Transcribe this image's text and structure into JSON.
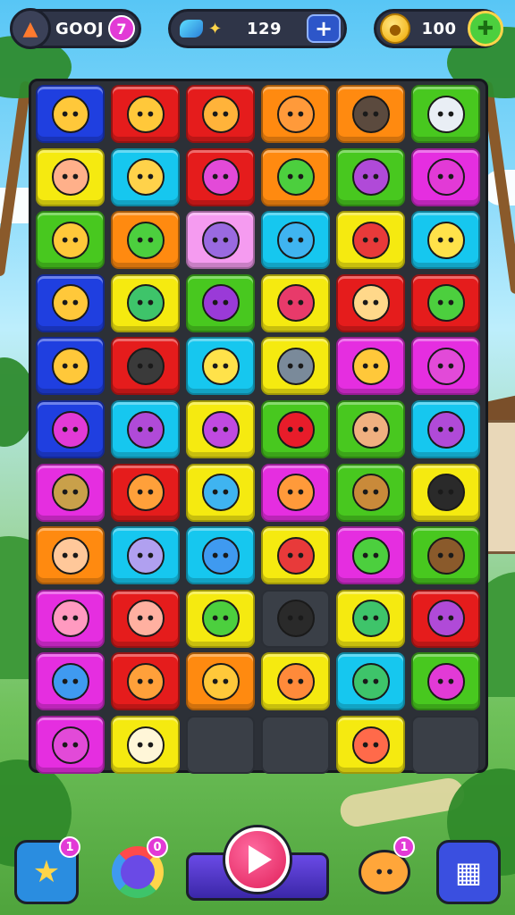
{
  "hud": {
    "left": {
      "avatar_icon": "dino-icon",
      "value": "GOOJ",
      "badge": "7"
    },
    "middle": {
      "gem_icon": "gem-icon",
      "character_icon": "runner-icon",
      "value": "129",
      "plus_label": "+"
    },
    "right": {
      "coin_icon": "coin-icon",
      "value": "100",
      "add_icon": "puzzle-plus-icon"
    }
  },
  "board": {
    "columns": 6,
    "rows": 11,
    "tile_colors": {
      "blue": "#1f3fe0",
      "red": "#e51c1c",
      "orange": "#ff8a10",
      "green": "#48c81f",
      "yellow": "#f5ea10",
      "cyan": "#16c7ef",
      "magenta": "#e52ee0",
      "pink": "#f59bf0",
      "empty": "#3a3f47"
    },
    "tiles": [
      [
        {
          "c": "blue",
          "i": "smile-face",
          "ic": "#ffc83a"
        },
        {
          "c": "red",
          "i": "lion-face",
          "ic": "#ffc83a"
        },
        {
          "c": "red",
          "i": "sun-creature",
          "ic": "#ffb33a"
        },
        {
          "c": "orange",
          "i": "round-face",
          "ic": "#ff9a3a"
        },
        {
          "c": "orange",
          "i": "bear-face",
          "ic": "#5b4a3e"
        },
        {
          "c": "green",
          "i": "cash-register",
          "ic": "#e9eef5"
        }
      ],
      [
        {
          "c": "yellow",
          "i": "pig-face",
          "ic": "#ffb08a"
        },
        {
          "c": "cyan",
          "i": "rocket",
          "ic": "#ffd24a"
        },
        {
          "c": "red",
          "i": "candy",
          "ic": "#e34ad8"
        },
        {
          "c": "orange",
          "i": "slime-face",
          "ic": "#4ccf3e"
        },
        {
          "c": "green",
          "i": "gem-shape",
          "ic": "#b04ad8"
        },
        {
          "c": "magenta",
          "i": "plum",
          "ic": "#e23ad6"
        }
      ],
      [
        {
          "c": "green",
          "i": "cat-face",
          "ic": "#ffc83a"
        },
        {
          "c": "orange",
          "i": "green-blob",
          "ic": "#4ccf3e"
        },
        {
          "c": "pink",
          "i": "pencil",
          "ic": "#9a6ae0"
        },
        {
          "c": "cyan",
          "i": "striped-ball",
          "ic": "#3fb4f0"
        },
        {
          "c": "yellow",
          "i": "red-face",
          "ic": "#e83a3a"
        },
        {
          "c": "cyan",
          "i": "yellow-face",
          "ic": "#ffe24a"
        }
      ],
      [
        {
          "c": "blue",
          "i": "cat-face",
          "ic": "#ffc83a"
        },
        {
          "c": "yellow",
          "i": "leaf",
          "ic": "#3ec46a"
        },
        {
          "c": "green",
          "i": "purple-eye",
          "ic": "#9a3ad8"
        },
        {
          "c": "yellow",
          "i": "marker",
          "ic": "#e83a6a"
        },
        {
          "c": "red",
          "i": "happy-face",
          "ic": "#ffd88a"
        },
        {
          "c": "red",
          "i": "green-monster",
          "ic": "#4ccf3e"
        }
      ],
      [
        {
          "c": "blue",
          "i": "cat-face",
          "ic": "#ffc83a"
        },
        {
          "c": "red",
          "i": "black-cat",
          "ic": "#3a3a3a"
        },
        {
          "c": "cyan",
          "i": "yellow-face",
          "ic": "#ffe24a"
        },
        {
          "c": "yellow",
          "i": "crossed-tools",
          "ic": "#7a8a9a"
        },
        {
          "c": "magenta",
          "i": "bear-face",
          "ic": "#ffc83a"
        },
        {
          "c": "magenta",
          "i": "pink-stool",
          "ic": "#e24ad8"
        }
      ],
      [
        {
          "c": "blue",
          "i": "plum",
          "ic": "#e23ad6"
        },
        {
          "c": "cyan",
          "i": "purple-cat",
          "ic": "#b04ad8"
        },
        {
          "c": "yellow",
          "i": "purple-candy",
          "ic": "#c04ae0"
        },
        {
          "c": "green",
          "i": "heart",
          "ic": "#e81c2a"
        },
        {
          "c": "green",
          "i": "monkey-face",
          "ic": "#f0b080"
        },
        {
          "c": "cyan",
          "i": "purple-cat",
          "ic": "#b04ad8"
        }
      ],
      [
        {
          "c": "magenta",
          "i": "crossed-tools",
          "ic": "#c9a04a"
        },
        {
          "c": "red",
          "i": "bear-face",
          "ic": "#ffa03a"
        },
        {
          "c": "yellow",
          "i": "blue-blob",
          "ic": "#3fb4f0"
        },
        {
          "c": "magenta",
          "i": "pencil",
          "ic": "#ff9a3a"
        },
        {
          "c": "green",
          "i": "basket",
          "ic": "#c98a3a"
        },
        {
          "c": "yellow",
          "i": "dark-blob",
          "ic": "#2a2a2a"
        }
      ],
      [
        {
          "c": "orange",
          "i": "bear-face",
          "ic": "#ffc89a"
        },
        {
          "c": "cyan",
          "i": "cash-register",
          "ic": "#b0a0f0"
        },
        {
          "c": "cyan",
          "i": "blue-face",
          "ic": "#3f9af0"
        },
        {
          "c": "yellow",
          "i": "red-hat",
          "ic": "#e83a3a"
        },
        {
          "c": "magenta",
          "i": "green-robot",
          "ic": "#4ccf3e"
        },
        {
          "c": "green",
          "i": "brown-box",
          "ic": "#8a5a2b"
        }
      ],
      [
        {
          "c": "magenta",
          "i": "pink-stool",
          "ic": "#ff9ac0"
        },
        {
          "c": "red",
          "i": "pig-face",
          "ic": "#ffb0a0"
        },
        {
          "c": "yellow",
          "i": "green-blob",
          "ic": "#4ccf3e"
        },
        {
          "c": "empty",
          "i": "dark-blob",
          "ic": "#2a2a2a"
        },
        {
          "c": "yellow",
          "i": "green-crate",
          "ic": "#3ec46a"
        },
        {
          "c": "red",
          "i": "plum",
          "ic": "#b04ad8"
        }
      ],
      [
        {
          "c": "magenta",
          "i": "blue-face",
          "ic": "#3f9af0"
        },
        {
          "c": "red",
          "i": "bear-face",
          "ic": "#ffa03a"
        },
        {
          "c": "orange",
          "i": "bear-face",
          "ic": "#ffc83a"
        },
        {
          "c": "yellow",
          "i": "orange-blob",
          "ic": "#ff8a3a"
        },
        {
          "c": "cyan",
          "i": "cash-register",
          "ic": "#3ec46a"
        },
        {
          "c": "green",
          "i": "plum",
          "ic": "#e23ad6"
        }
      ],
      [
        {
          "c": "magenta",
          "i": "pink-frame",
          "ic": "#e24ad8"
        },
        {
          "c": "yellow",
          "i": "cream-face",
          "ic": "#fff6d8"
        },
        {
          "c": "empty",
          "i": "",
          "ic": ""
        },
        {
          "c": "empty",
          "i": "",
          "ic": ""
        },
        {
          "c": "yellow",
          "i": "red-face",
          "ic": "#ff6a4a"
        },
        {
          "c": "empty",
          "i": "",
          "ic": ""
        }
      ]
    ]
  },
  "bottom_bar": {
    "star_button": {
      "icon": "star-plus-icon",
      "badge": "1",
      "color": "#2a8de0"
    },
    "ring_button": {
      "icon": "rainbow-ring-icon",
      "badge": "0"
    },
    "play_button": {
      "icon": "play-icon"
    },
    "bear_button": {
      "icon": "bear-face-icon",
      "badge": "1"
    },
    "grid_button": {
      "icon": "grid-icon",
      "color": "#3a4fe0"
    }
  }
}
